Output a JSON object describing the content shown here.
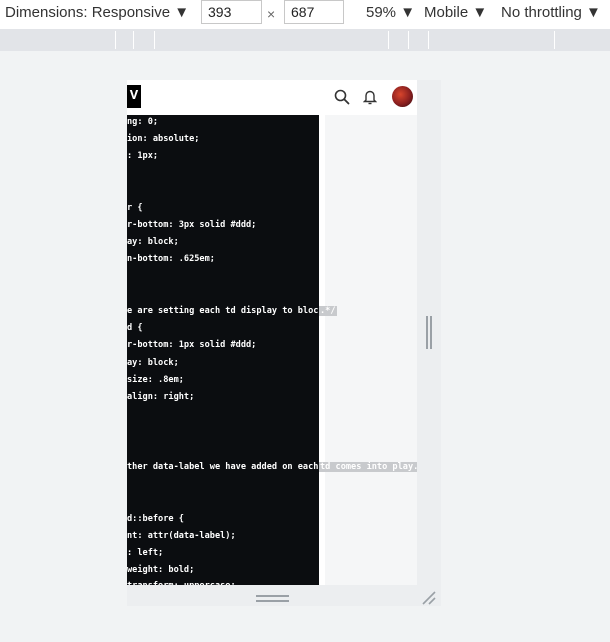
{
  "toolbar": {
    "dimensions_label": "Dimensions: Responsive ▼",
    "width_value": "393",
    "times": "×",
    "height_value": "687",
    "zoom": "59% ▼",
    "device_type": "Mobile ▼",
    "throttling": "No throttling ▼"
  },
  "app": {
    "logo_text": "V"
  },
  "code_lines": [
    "ng: 0;",
    "ion: absolute;",
    ": 1px;",
    "r {",
    "r-bottom: 3px solid #ddd;",
    "ay: block;",
    "n-bottom: .625em;",
    "e are setting each td display to block",
    "d {",
    "r-bottom: 1px solid #ddd;",
    "ay: block;",
    "size: .8em;",
    "align: right;",
    "ther data-label we have added on each",
    "d::before {",
    "nt: attr(data-label);",
    ": left;",
    "weight: bold;",
    "transform: uppercase;"
  ],
  "overflow_text": {
    "block_comment": ".*/",
    "play_comment": "td comes into play."
  },
  "colors": {
    "code_bg": "#0b0d10",
    "toolbar_bg": "#ffffff",
    "ruler_bg": "#e2e4e8",
    "viewport_bg": "#f1f3f4"
  },
  "icons": {
    "search": "search-icon",
    "bell": "bell-icon",
    "avatar": "avatar",
    "resize": "resize-corner-icon"
  }
}
